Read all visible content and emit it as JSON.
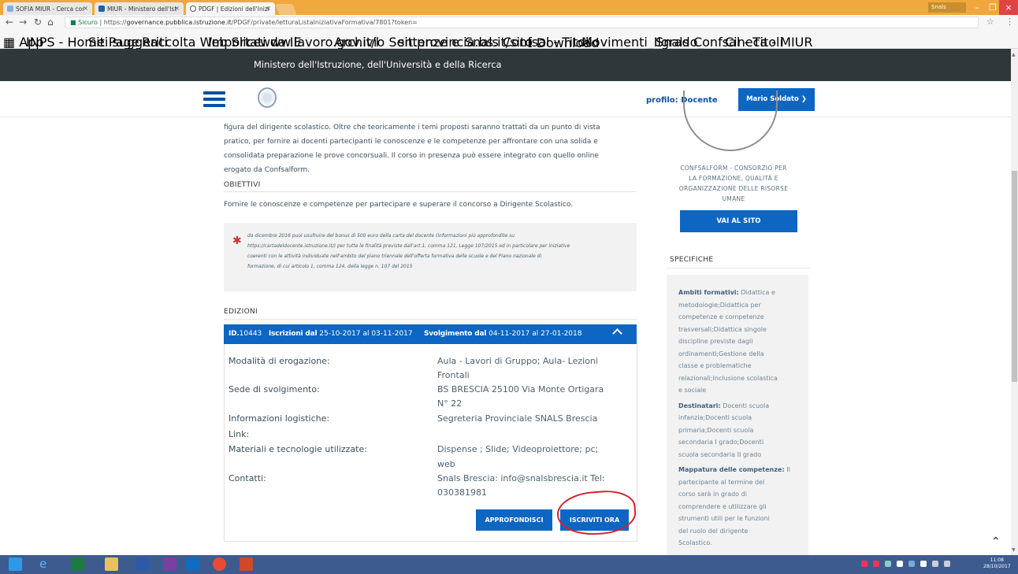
{
  "browser": {
    "tabs": [
      {
        "title": "SOFIA MIUR - Cerca cor",
        "favicon_color": "#7fb1e4"
      },
      {
        "title": "MIUR - Ministero dell'Ist",
        "favicon_color": "#1d63a8"
      },
      {
        "title": "PDGF | Edizioni dell'Inizi",
        "favicon_color": "#555555"
      }
    ],
    "user": "Snals",
    "url_secure": "Sicuro",
    "url_scheme": "https://",
    "url_host": "governance.pubblica.istruzione.it",
    "url_path": "/PDGF/private/letturaListaIniziativaFormativa/7801?token=",
    "bookmarks": [
      "App",
      "INPS - Home Page",
      "Siti suggeriti",
      "Raccolta Web Slice",
      "Importati da IE",
      "www.lavoro.gov.it/l",
      "Archivio Sentenze e",
      "sit.provincia.bs.it/sito",
      "Snals Confsal - Titoli",
      "Download",
      "Movimenti_Ilgrado_",
      "Snals Confsal - Titoli",
      "Cineca - MIUR"
    ]
  },
  "site": {
    "ministry": "Ministero dell'Istruzione, dell'Università e della Ricerca",
    "profile": "profilo: Docente",
    "user": "Mario Soldato"
  },
  "content": {
    "intro": [
      "figura del dirigente scolastico. Oltre che teoricamente i temi proposti saranno trattati da un punto di vista",
      "pratico, per fornire ai docenti partecipanti le conoscenze e le competenze per affrontare con una solida e",
      "consolidata preparazione le prove concorsuali. Il corso in presenza può essere integrato con quello online",
      "erogato da Confsalform."
    ],
    "obiettivi_title": "OBIETTIVI",
    "obiettivi_text": "Fornire le conoscenze e competenze per partecipare e superare il concorso a Dirigente Scolastico.",
    "note_lines": [
      "da dicembre 2016 puoi usufruire del bonus di 500 euro della carta del docente (informazioni più approfondite su",
      "https://cartadeldocente.istruzione.it/) per tutte le finalità previste dall'art.1, comma 121, Legge 107/2015 ed in particolare per iniziative",
      "coerenti con le attività individuate nell'ambito del piano triennale dell'offerta formativa delle scuole e del Piano nazionale di",
      "formazione, di cui articolo 1, comma 124, della legge n. 107 del 2015"
    ],
    "edizioni_title": "EDIZIONI",
    "edition": {
      "id_label": "ID.",
      "id": "10443",
      "iscr_label": "Iscrizioni dal",
      "iscr_from": "25-10-2017",
      "al": "al",
      "iscr_to": "03-11-2017",
      "svolg_label": "Svolgimento dal",
      "svolg_from": "04-11-2017",
      "svolg_to": "27-01-2018",
      "labels": {
        "modalita": "Modalità di erogazione:",
        "sede": "Sede di svolgimento:",
        "info": "Informazioni logistiche:",
        "link": "Link:",
        "materiali": "Materiali e tecnologie utilizzate:",
        "contatti": "Contatti:"
      },
      "modalita": [
        "Aula - Lavori di Gruppo; Aula- Lezioni",
        "Frontali"
      ],
      "sede": [
        "BS BRESCIA 25100 Via Monte Ortigara",
        "N° 22"
      ],
      "info": "Segreteria Provinciale SNALS Brescia",
      "materiali": [
        "Dispense ; Slide; Videoproiettore; pc;",
        "web"
      ],
      "contatti": [
        "Snals Brescia: info@snalsbrescia.it Tel:",
        "030381981"
      ],
      "btn_approfondisci": "APPROFONDISCI",
      "btn_iscriviti": "ISCRIVITI ORA",
      "highlight_color": "#d8202a"
    }
  },
  "side": {
    "org_lines": [
      "CONFSALFORM - CONSORZIO PER",
      "LA FORMAZIONE, QUALITÀ E",
      "ORGANIZZAZIONE DELLE RISORSE",
      "UMANE"
    ],
    "vai_al_sito": "VAI AL SITO",
    "specifiche_title": "SPECIFICHE",
    "spec_lines": [
      {
        "b": "Ambiti formativi:",
        "t": " Didattica e"
      },
      {
        "b": "",
        "t": "metodologie;Didattica per"
      },
      {
        "b": "",
        "t": "competenze e competenze"
      },
      {
        "b": "",
        "t": "trasversali;Didattica singole"
      },
      {
        "b": "",
        "t": "discipline previste dagli"
      },
      {
        "b": "",
        "t": "ordinamenti;Gestione della"
      },
      {
        "b": "",
        "t": "classe e problematiche"
      },
      {
        "b": "",
        "t": "relazionali;Inclusione scolastica"
      },
      {
        "b": "",
        "t": "e sociale"
      },
      {
        "b": "Destinatari:",
        "t": " Docenti scuola"
      },
      {
        "b": "",
        "t": "infanzia;Docenti scuola"
      },
      {
        "b": "",
        "t": "primaria;Docenti scuola"
      },
      {
        "b": "",
        "t": "secondaria I grado;Docenti"
      },
      {
        "b": "",
        "t": "scuola secondaria II grado"
      },
      {
        "b": "Mappatura delle competenze:",
        "t": " Il"
      },
      {
        "b": "",
        "t": "partecipante al termine del"
      },
      {
        "b": "",
        "t": "corso sarà in grado di"
      },
      {
        "b": "",
        "t": "comprendere e utilizzare gli"
      },
      {
        "b": "",
        "t": "strumenti utili per le funzioni"
      },
      {
        "b": "",
        "t": "del ruolo del dirigente"
      },
      {
        "b": "",
        "t": "Scolastico."
      }
    ]
  },
  "taskbar": {
    "time": "11:08",
    "date": "28/10/2017"
  }
}
